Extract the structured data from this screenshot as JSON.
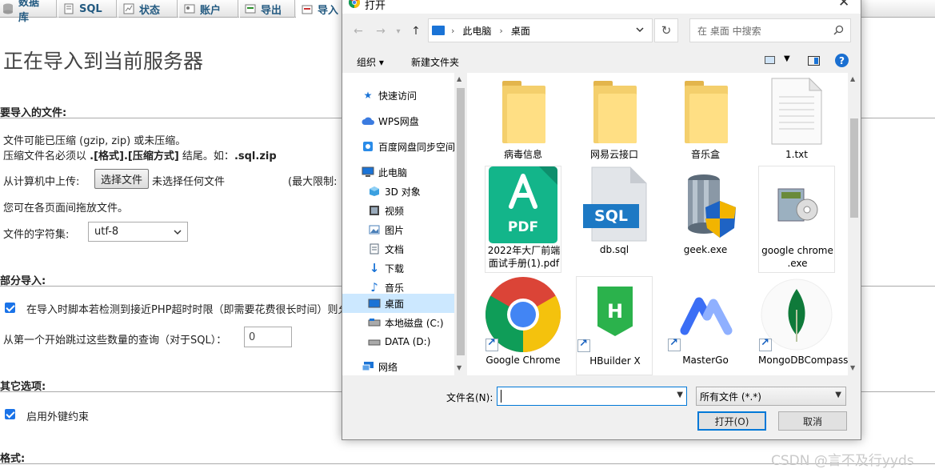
{
  "background": {
    "tabs": [
      {
        "label": "数据库",
        "icon": "database-icon"
      },
      {
        "label": "SQL",
        "icon": "sql-icon"
      },
      {
        "label": "状态",
        "icon": "status-icon"
      },
      {
        "label": "账户",
        "icon": "accounts-icon"
      },
      {
        "label": "导出",
        "icon": "export-icon"
      },
      {
        "label": "导入",
        "icon": "import-icon"
      }
    ],
    "page_title": "正在导入到当前服务器",
    "sections": {
      "file_to_import": "要导入的文件:",
      "partial_import": "部分导入:",
      "other_options": "其它选项:",
      "format": "格式:"
    },
    "file_note_1": "文件可能已压缩 (gzip, zip) 或未压缩。",
    "file_note_2_prefix": "压缩文件名必须以 ",
    "file_note_2_format": ".[格式].[压缩方式]",
    "file_note_2_mid": " 结尾。如：",
    "file_note_2_example": ".sql.zip",
    "upload_label": "从计算机中上传:",
    "choose_file_button": "选择文件",
    "no_file_chosen": "未选择任何文件",
    "max_limit": "(最大限制:",
    "drag_hint": "您可在各页面间拖放文件。",
    "charset_label": "文件的字符集:",
    "charset_value": "utf-8",
    "partial_option": "在导入时脚本若检测到接近PHP超时时限（即需要花费很长时间）则允",
    "skip_label": "从第一个开始跳过这些数量的查询（对于SQL）：",
    "skip_value": "0",
    "foreign_key_label": "启用外键约束"
  },
  "watermark": "CSDN @言不及行yyds",
  "dialog": {
    "title": "打开",
    "close": "✕",
    "breadcrumb": [
      "此电脑",
      "桌面"
    ],
    "search_placeholder": "在 桌面 中搜索",
    "organize": "组织 ▾",
    "new_folder": "新建文件夹",
    "help": "?",
    "tree": [
      {
        "label": "快速访问",
        "icon": "star-icon",
        "color": "#1a73d6"
      },
      {
        "label": "WPS网盘",
        "icon": "cloud-icon",
        "color": "#3b7be0"
      },
      {
        "label": "百度网盘同步空间",
        "icon": "baidu-icon",
        "color": "#2a8be8"
      },
      {
        "label": "此电脑",
        "icon": "computer-icon",
        "color": "#1a73d6"
      },
      {
        "label": "3D 对象",
        "icon": "cube-icon",
        "color": "#3ba0e0"
      },
      {
        "label": "视频",
        "icon": "video-icon",
        "color": "#444444"
      },
      {
        "label": "图片",
        "icon": "picture-icon",
        "color": "#4a7fb8"
      },
      {
        "label": "文档",
        "icon": "document-icon",
        "color": "#5a6a7a"
      },
      {
        "label": "下载",
        "icon": "download-icon",
        "color": "#1a73d6"
      },
      {
        "label": "音乐",
        "icon": "music-icon",
        "color": "#1a73d6"
      },
      {
        "label": "桌面",
        "icon": "desktop-icon",
        "color": "#1a73d6"
      },
      {
        "label": "本地磁盘 (C:)",
        "icon": "drive-icon",
        "color": "#555555"
      },
      {
        "label": "DATA (D:)",
        "icon": "drive-icon",
        "color": "#555555"
      },
      {
        "label": "网络",
        "icon": "network-icon",
        "color": "#1a73d6"
      }
    ],
    "files": [
      {
        "label": "病毒信息",
        "icon": "folder-icon"
      },
      {
        "label": "网易云接口",
        "icon": "folder-icon"
      },
      {
        "label": "音乐盒",
        "icon": "folder-icon"
      },
      {
        "label": "1.txt",
        "icon": "text-file-icon"
      },
      {
        "label": "2022年大厂前端面试手册(1).pdf",
        "icon": "pdf-file-icon",
        "badge": "PDF"
      },
      {
        "label": "db.sql",
        "icon": "sql-file-icon",
        "badge": "SQL"
      },
      {
        "label": "geek.exe",
        "icon": "geek-app-icon"
      },
      {
        "label": "google chrome .exe",
        "icon": "installer-icon"
      },
      {
        "label": "Google Chrome",
        "icon": "chrome-icon"
      },
      {
        "label": "HBuilder X",
        "icon": "hbuilder-icon",
        "badge": "H"
      },
      {
        "label": "MasterGo",
        "icon": "mastergo-icon"
      },
      {
        "label": "MongoDBCompassBeta",
        "icon": "mongodb-icon"
      }
    ],
    "filename_label": "文件名(N):",
    "filename_value": "",
    "file_type_filter": "所有文件 (*.*)",
    "open_button": "打开(O)",
    "cancel_button": "取消",
    "colors": {
      "accent": "#0078d7",
      "selection": "#cce8ff",
      "folder": "#ffdf84"
    }
  }
}
